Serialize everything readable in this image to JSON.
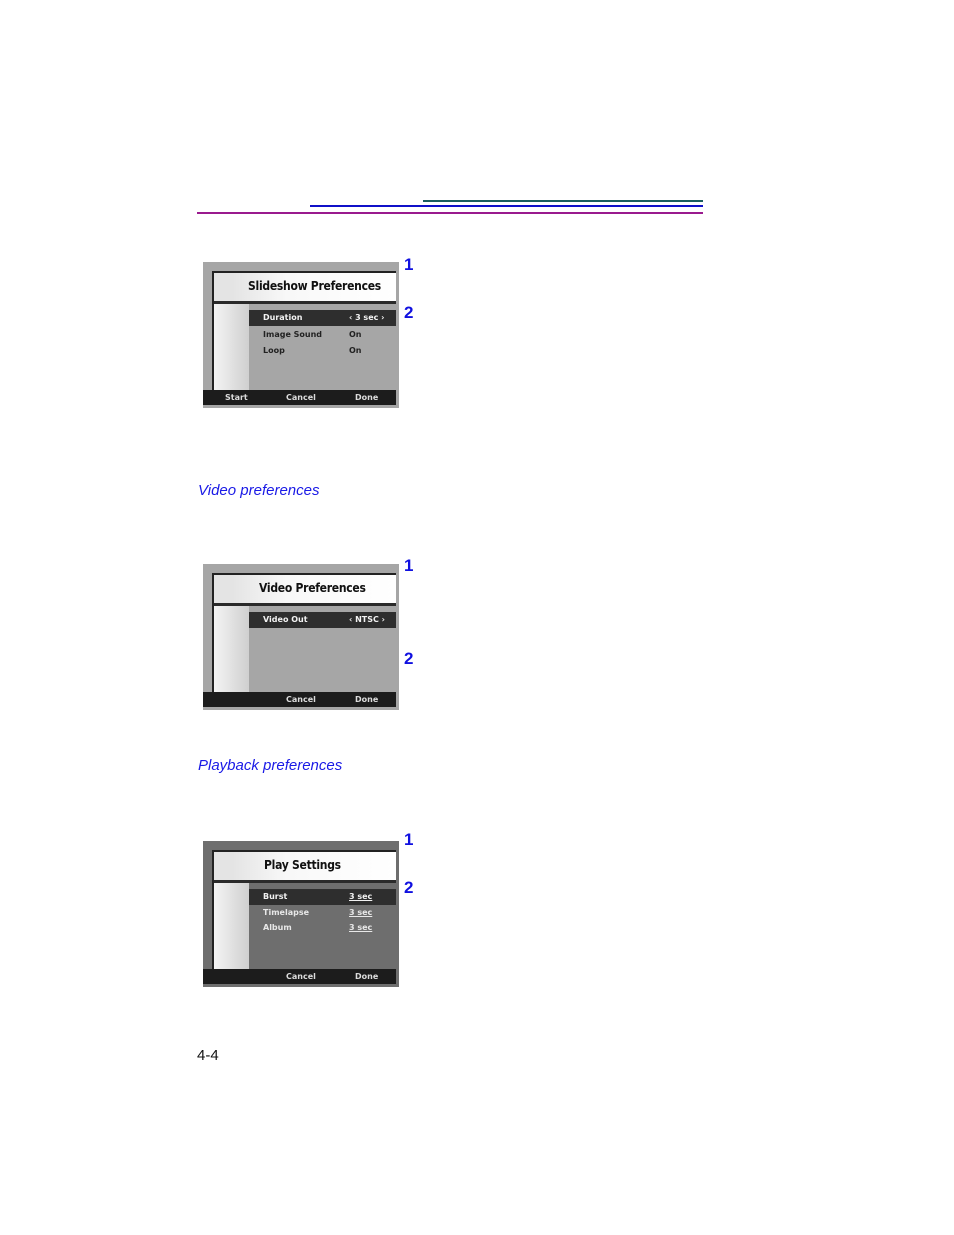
{
  "page": {
    "page_number": "4-4",
    "accent_colors": {
      "caption": "#1a1ae6",
      "callout": "#1010e0",
      "rule_teal": "#1a5e5e",
      "rule_blue": "#1010c8",
      "rule_magenta": "#9a1a8e"
    }
  },
  "sections": [
    {
      "caption": "",
      "screen": {
        "title": "Slideshow Preferences",
        "rows": [
          {
            "label": "Duration",
            "value": "‹ 3 sec ›",
            "selected": true
          },
          {
            "label": "Image Sound",
            "value": "On",
            "selected": false
          },
          {
            "label": "Loop",
            "value": "On",
            "selected": false
          }
        ],
        "buttons": {
          "start": "Start",
          "cancel": "Cancel",
          "done": "Done"
        }
      },
      "callouts": [
        "1",
        "2"
      ]
    },
    {
      "caption": "Video preferences",
      "screen": {
        "title": "Video Preferences",
        "rows": [
          {
            "label": "Video Out",
            "value": "‹ NTSC ›",
            "selected": true
          }
        ],
        "buttons": {
          "cancel": "Cancel",
          "done": "Done"
        }
      },
      "callouts": [
        "1",
        "2"
      ]
    },
    {
      "caption": "Playback preferences",
      "screen": {
        "title": "Play Settings",
        "rows": [
          {
            "label": "Burst",
            "value": "3 sec",
            "selected": true
          },
          {
            "label": "Timelapse",
            "value": "3 sec",
            "selected": false
          },
          {
            "label": "Album",
            "value": "3 sec",
            "selected": false
          }
        ],
        "buttons": {
          "cancel": "Cancel",
          "done": "Done"
        }
      },
      "callouts": [
        "1",
        "2"
      ]
    }
  ]
}
